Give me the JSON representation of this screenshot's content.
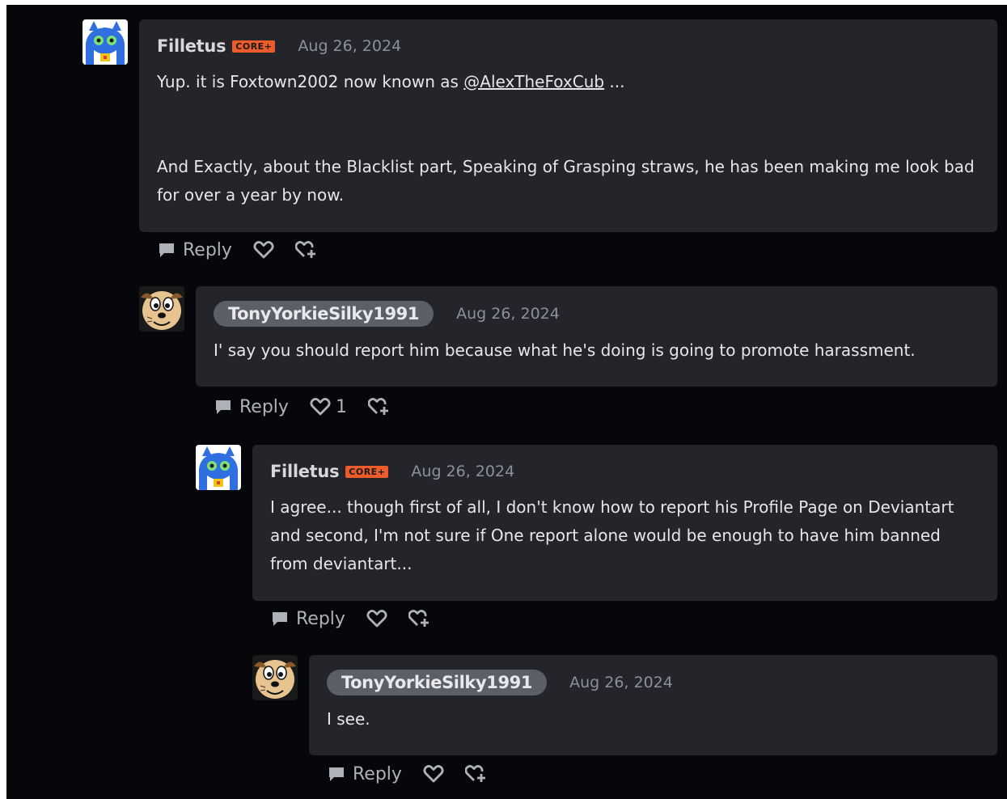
{
  "comments": [
    {
      "author": "Filletus",
      "badge": "CORE+",
      "date": "Aug 26, 2024",
      "text_before_mention": "Yup. it is Foxtown2002 now known as ",
      "mention": "@AlexTheFoxCub",
      "text_after_mention": " ...",
      "paragraph2": "And Exactly, about the Blacklist part, Speaking of Grasping straws, he has been making me look bad for over a year by now.",
      "reply_label": "Reply"
    },
    {
      "author": "TonyYorkieSilky1991",
      "date": "Aug 26, 2024",
      "text": "I' say you should report him because what he's doing is going to promote harassment.",
      "reply_label": "Reply",
      "like_count": "1"
    },
    {
      "author": "Filletus",
      "badge": "CORE+",
      "date": "Aug 26, 2024",
      "text": "I agree... though first of all, I don't know how to report his Profile Page on Deviantart and second, I'm not sure if One report alone would be enough to have him banned from deviantart...",
      "reply_label": "Reply"
    },
    {
      "author": "TonyYorkieSilky1991",
      "date": "Aug 26, 2024",
      "text": "I see.",
      "reply_label": "Reply"
    }
  ],
  "icons": {
    "reply": "speech-bubble-icon",
    "like": "heart-icon",
    "fave": "favourite-plus-icon"
  },
  "colors": {
    "background": "#06070a",
    "card": "#23252b",
    "core_badge": "#ec5b2a",
    "name_pill": "#5c5f67"
  }
}
